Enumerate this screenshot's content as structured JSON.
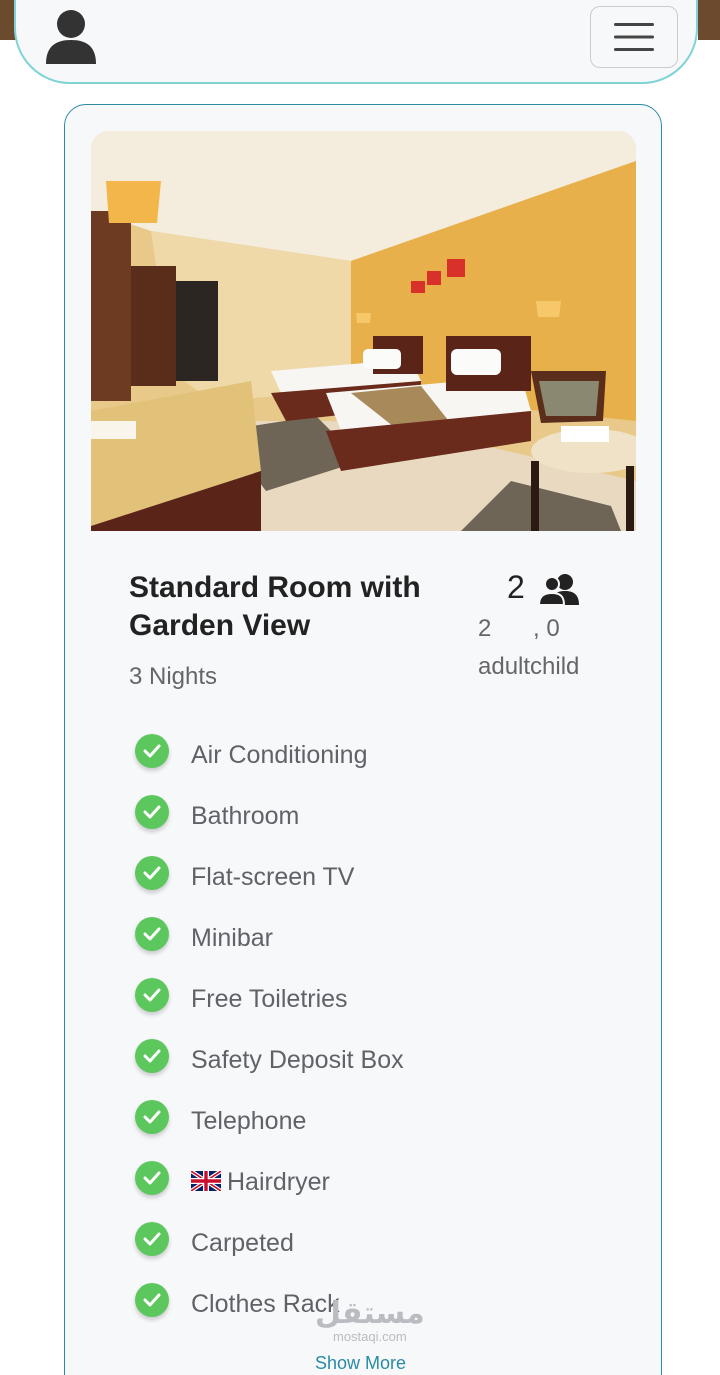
{
  "navbar": {
    "user_icon": "user-icon",
    "menu_icon": "hamburger-menu-icon"
  },
  "room": {
    "title": "Standard Room with Garden View",
    "nights": "3 Nights",
    "guests_total": "2",
    "guests_icon": "users-icon",
    "adults": "2",
    "children": ", 0",
    "guest_labels": "adultchild"
  },
  "amenities": [
    "Air Conditioning",
    "Bathroom",
    "Flat-screen TV",
    "Minibar",
    "Free Toiletries",
    "Safety Deposit Box",
    "Telephone",
    "Hairdryer",
    "Carpeted",
    "Clothes Rack"
  ],
  "show_more": "Show More",
  "watermark": {
    "arabic": "مستقل",
    "latin": "mostaqi.com"
  },
  "colors": {
    "accent": "#2a8aa6",
    "check": "#5cc75c",
    "navbar_border": "#7fd3d6"
  }
}
